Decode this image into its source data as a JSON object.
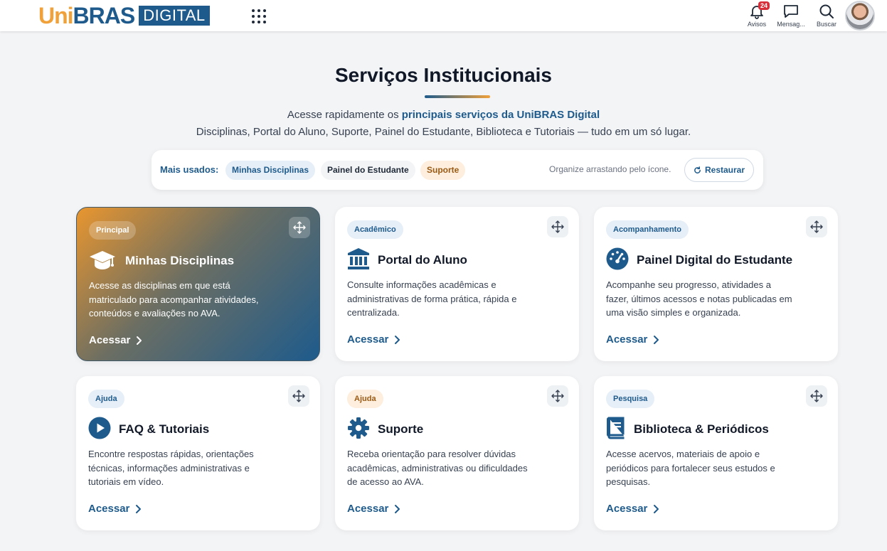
{
  "header": {
    "logo": {
      "uni": "Uni",
      "bras": "BRAS",
      "digital": "DIGITAL"
    },
    "apps_icon": "grid-dots-icon",
    "tools": {
      "avisos": {
        "label": "Avisos",
        "count": "24",
        "icon": "bell-icon"
      },
      "mensagens": {
        "label": "Mensag...",
        "icon": "chat-icon"
      },
      "buscar": {
        "label": "Buscar",
        "icon": "search-icon"
      }
    }
  },
  "page": {
    "title": "Serviços Institucionais",
    "intro_prefix": "Acesse rapidamente os ",
    "intro_highlight": "principais serviços da UniBRAS Digital",
    "intro_line2": "Disciplinas, Portal do Aluno, Suporte, Painel do Estudante, Biblioteca e Tutoriais — tudo em um só lugar."
  },
  "mais_usados": {
    "label": "Mais usados:",
    "chips": [
      "Minhas Disciplinas",
      "Painel do Estudante",
      "Suporte"
    ],
    "organize_hint": "Organize arrastando pelo ícone.",
    "restore_label": "Restaurar"
  },
  "cards": [
    {
      "tag": "Principal",
      "title": "Minhas Disciplinas",
      "icon": "graduation-cap-icon",
      "description": "Acesse as disciplinas em que está matriculado para acompanhar atividades, conteúdos e avaliações no AVA.",
      "cta": "Acessar"
    },
    {
      "tag": "Acadêmico",
      "title": "Portal do Aluno",
      "icon": "institution-icon",
      "description": "Consulte informações acadêmicas e administrativas de forma prática, rápida e centralizada.",
      "cta": "Acessar"
    },
    {
      "tag": "Acompanhamento",
      "title": "Painel Digital do Estudante",
      "icon": "gauge-icon",
      "description": "Acompanhe seu progresso, atividades a fazer, últimos acessos e notas publicadas em uma visão simples e organizada.",
      "cta": "Acessar"
    },
    {
      "tag": "Ajuda",
      "title": "FAQ & Tutoriais",
      "icon": "play-circle-icon",
      "description": "Encontre respostas rápidas, orientações técnicas, informações administrativas e tutoriais em vídeo.",
      "cta": "Acessar"
    },
    {
      "tag": "Ajuda",
      "title": "Suporte",
      "icon": "gear-icon",
      "description": "Receba orientação para resolver dúvidas acadêmicas, administrativas ou dificuldades de acesso ao AVA.",
      "cta": "Acessar"
    },
    {
      "tag": "Pesquisa",
      "title": "Biblioteca & Periódicos",
      "icon": "book-icon",
      "description": "Acesse acervos, materiais de apoio e periódicos para fortalecer seus estudos e pesquisas.",
      "cta": "Acessar"
    }
  ],
  "colors": {
    "brand_blue": "#1e5b8c",
    "brand_orange": "#f0a13a",
    "badge_red": "#d62f3a"
  }
}
